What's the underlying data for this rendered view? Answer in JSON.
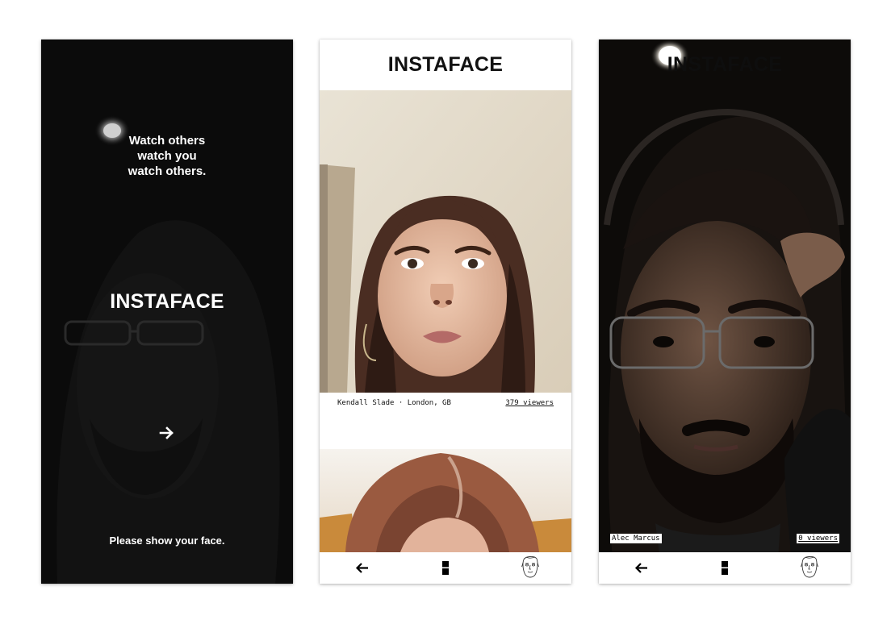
{
  "splash": {
    "tagline": [
      "Watch others",
      "watch you",
      "watch others."
    ],
    "brand": "INSTAFACE",
    "arrow_icon": "arrow-right-icon",
    "prompt": "Please show your face."
  },
  "feed": {
    "header_title": "INSTAFACE",
    "posts": [
      {
        "caption": "Kendall Slade · London, GB",
        "viewers": "379 viewers"
      }
    ]
  },
  "self_view": {
    "header_title": "INSTAFACE",
    "name": "Alec Marcus",
    "viewers": "0 viewers"
  },
  "bottom_nav": {
    "icons": [
      "arrow-left-icon",
      "feed-icon",
      "face-sketch-icon"
    ]
  },
  "colors": {
    "background": "#ffffff",
    "splash_background": "#0b0b0b",
    "text_dark": "#111111",
    "text_light": "#ffffff"
  }
}
